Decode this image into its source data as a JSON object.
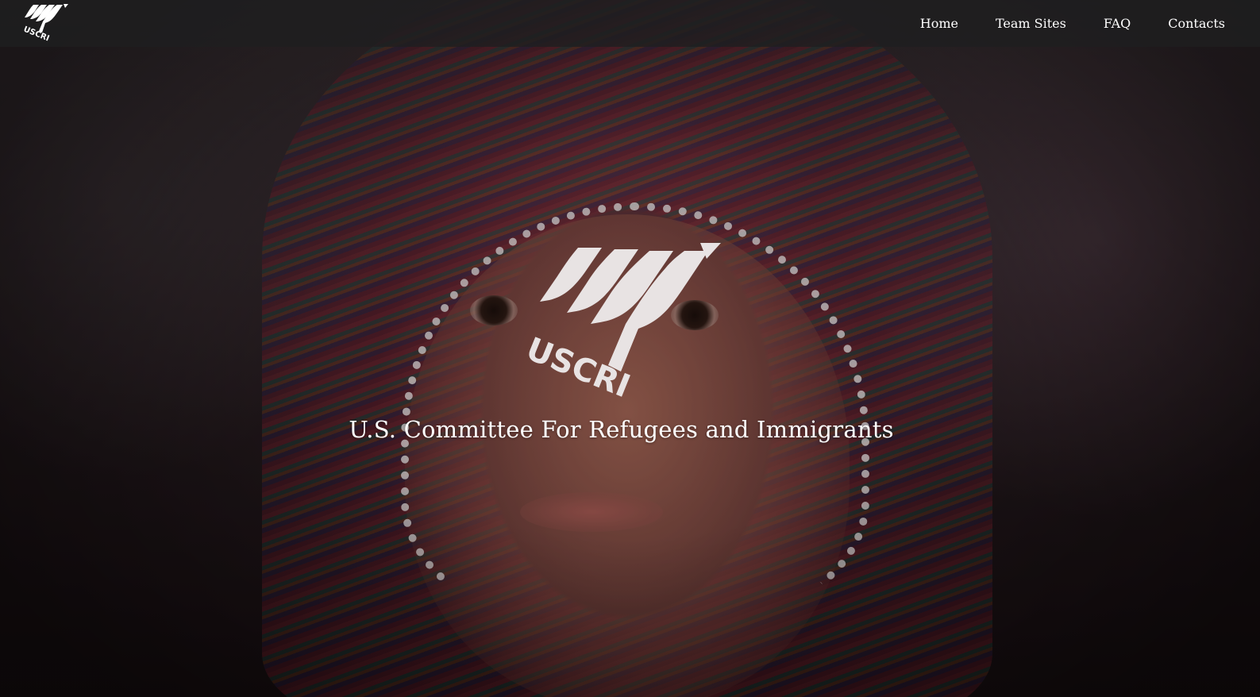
{
  "brand": {
    "logo_icon": "uscri-logo-icon",
    "logo_text": "USCRI"
  },
  "nav": {
    "items": [
      {
        "label": "Home"
      },
      {
        "label": "Team Sites"
      },
      {
        "label": "FAQ"
      },
      {
        "label": "Contacts"
      }
    ]
  },
  "hero": {
    "logo_icon": "uscri-logo-icon",
    "logo_text": "USCRI",
    "title": "U.S. Committee For Refugees and Immigrants",
    "background_image": "photo of child in striped headscarf"
  },
  "colors": {
    "navbar": "#1e1e20",
    "text": "#ffffff",
    "logo": "#e8e3e3"
  }
}
